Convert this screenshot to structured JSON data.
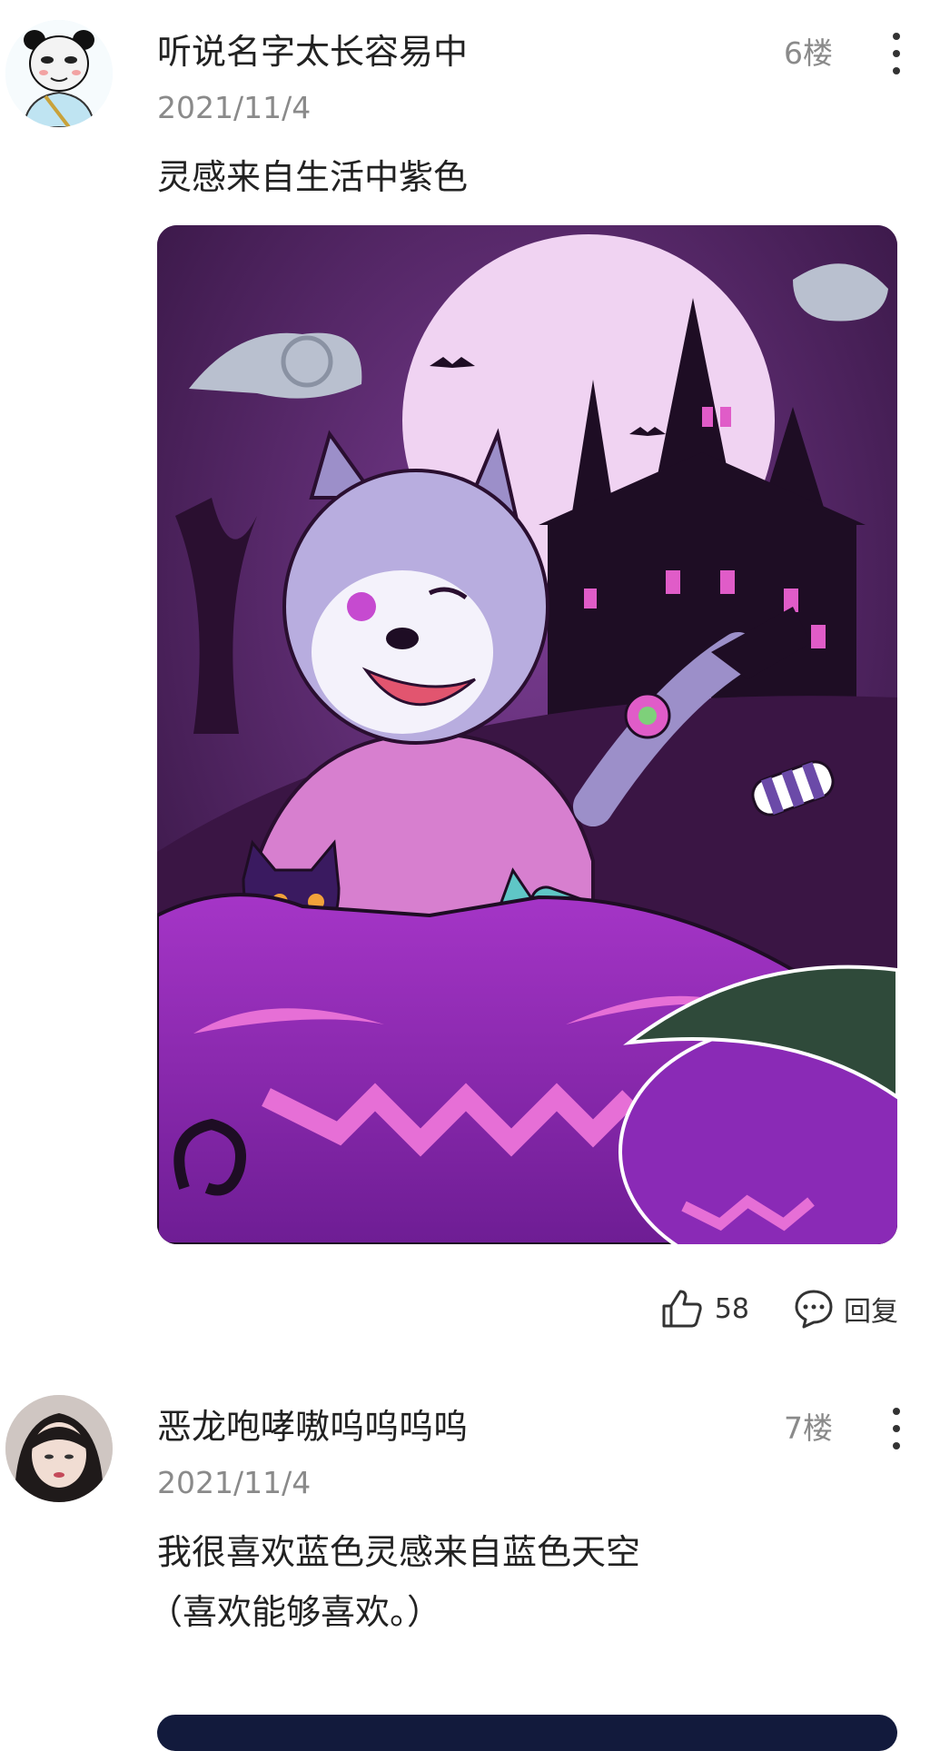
{
  "comments": [
    {
      "username": "听说名字太长容易中",
      "date": "2021/11/4",
      "floor": "6楼",
      "text_lines": [
        "灵感来自生活中紫色"
      ],
      "has_image": true,
      "likes": "58",
      "reply_label": "回复"
    },
    {
      "username": "恶龙咆哮嗷呜呜呜呜",
      "date": "2021/11/4",
      "floor": "7楼",
      "text_lines": [
        "我很喜欢蓝色灵感来自蓝色天空",
        "（喜欢能够喜欢。）"
      ]
    }
  ],
  "colors": {
    "text": "#222222",
    "meta": "#8a8a8a",
    "art_purple": "#8e2fb0",
    "art_moon": "#f2d6f3"
  },
  "icons": [
    "more-vertical-icon",
    "thumbs-up-icon",
    "comment-bubble-icon"
  ]
}
